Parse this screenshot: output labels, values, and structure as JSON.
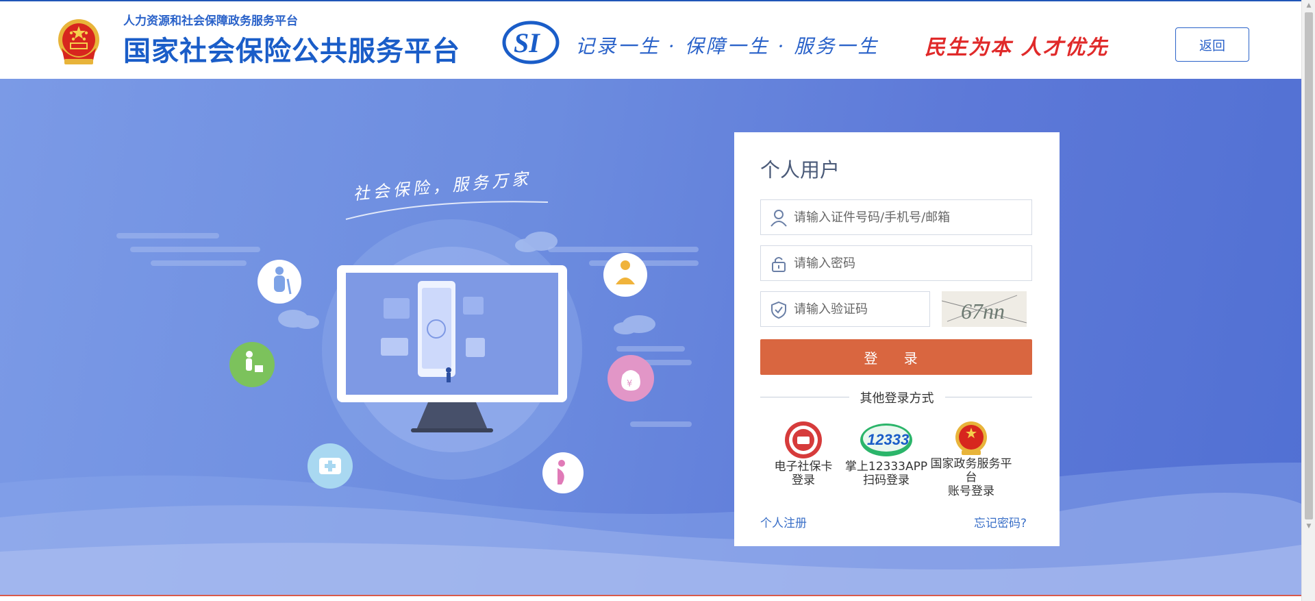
{
  "header": {
    "sub_title": "人力资源和社会保障政务服务平台",
    "main_title": "国家社会保险公共服务平台",
    "logo_text": "SI",
    "slogan": "记录一生 · 保障一生 · 服务一生",
    "slogan_right": "民生为本  人才优先",
    "back_label": "返回"
  },
  "hero": {
    "tagline": "社会保险，服务万家",
    "icons": [
      "elderly-icon",
      "injury-icon",
      "unemployment-icon",
      "money-bag-icon",
      "medical-icon",
      "maternity-icon"
    ]
  },
  "login": {
    "title": "个人用户",
    "username_placeholder": "请输入证件号码/手机号/邮箱",
    "password_placeholder": "请输入密码",
    "captcha_placeholder": "请输入验证码",
    "captcha_text": "67nn",
    "submit_label": "登 录",
    "other_methods_label": "其他登录方式",
    "methods": [
      {
        "line1": "电子社保卡",
        "line2": "登录",
        "icon": "social-security-card-icon"
      },
      {
        "line1": "掌上12333APP",
        "line2": "扫码登录",
        "icon": "app-12333-icon",
        "badge": "12333"
      },
      {
        "line1": "国家政务服务平台",
        "line2": "账号登录",
        "icon": "national-emblem-icon"
      }
    ],
    "register_label": "个人注册",
    "forgot_label": "忘记密码?"
  },
  "colors": {
    "brand_blue": "#1a5dc8",
    "hero_blue": "#6c8cdf",
    "login_orange": "#d96640",
    "slogan_red": "#e02a2a"
  }
}
